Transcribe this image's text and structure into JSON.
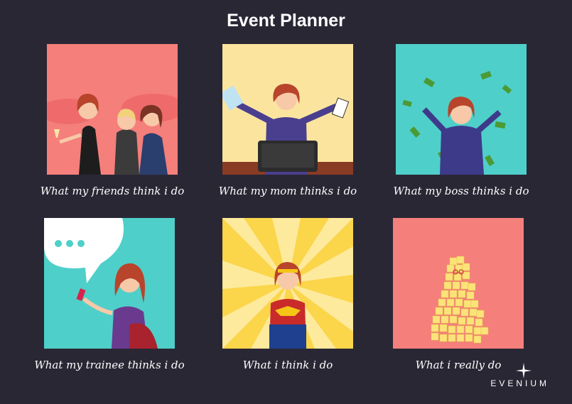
{
  "title": "Event Planner",
  "panels": [
    {
      "caption": "What my friends think i do",
      "bg": "#f47f7b"
    },
    {
      "caption": "What my mom thinks i do",
      "bg": "#fbe59e"
    },
    {
      "caption": "What my boss thinks i do",
      "bg": "#4fcfc9"
    },
    {
      "caption": "What my trainee thinks i do",
      "bg": "#4fcfc9"
    },
    {
      "caption": "What i think i do",
      "bg": "#fbd54a"
    },
    {
      "caption": "What i really do",
      "bg": "#f47f7b"
    }
  ],
  "brand": "EVENIUM"
}
